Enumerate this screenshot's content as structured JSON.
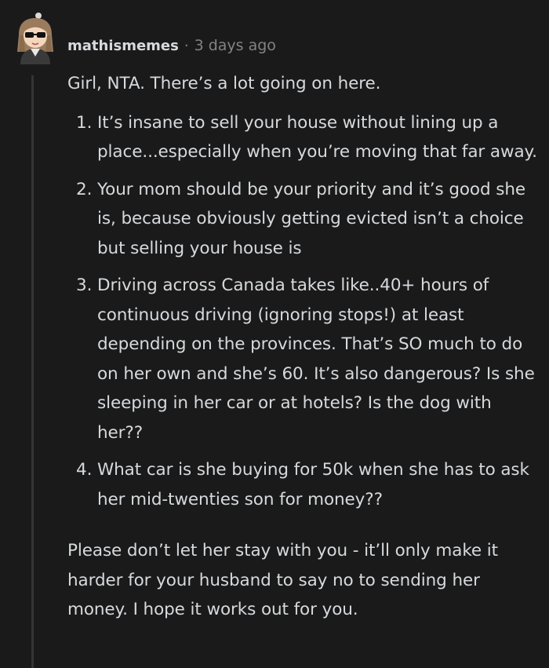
{
  "comment": {
    "username": "mathismemes",
    "separator": "·",
    "timestamp": "3 days ago",
    "intro": "Girl, NTA. There’s a lot going on here.",
    "list": [
      {
        "num": "1.",
        "text": "It’s insane to sell your house without lining up a place...especially when you’re moving that far away."
      },
      {
        "num": "2.",
        "text": "Your mom should be your priority and it’s good she is, because obviously getting evicted isn’t a choice but selling your house is"
      },
      {
        "num": "3.",
        "text": "Driving across Canada takes like..40+ hours of continuous driving (ignoring stops!) at least depending on the provinces. That’s SO much to do on her own and she’s 60. It’s also dangerous? Is she sleeping in her car or at hotels? Is the dog with her??"
      },
      {
        "num": "4.",
        "text": "What car is she buying for 50k when she has to ask her mid-twenties son for money??"
      }
    ],
    "closing": "Please don’t let her stay with you - it’ll only make it harder for your husband to say no to sending her money. I hope it works out for you."
  },
  "colors": {
    "background": "#1a1a1b",
    "text": "#d7dadc",
    "meta": "#818384",
    "thread_line": "#343536"
  },
  "icons": {
    "avatar": "user-avatar-girl-sunglasses"
  }
}
